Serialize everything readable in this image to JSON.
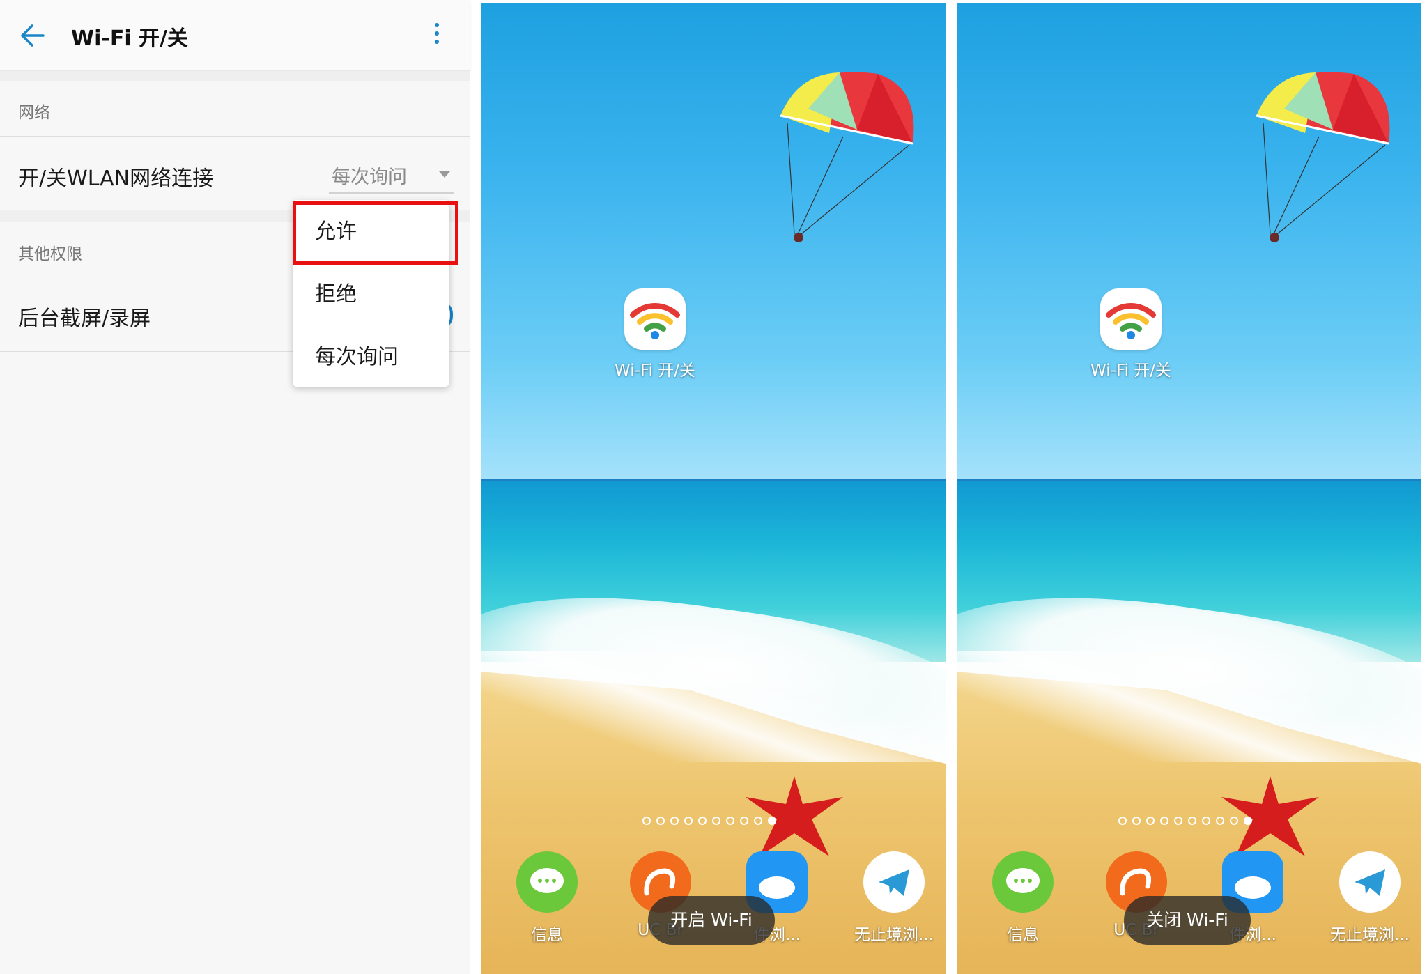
{
  "settings": {
    "title": "Wi-Fi 开/关",
    "sections": [
      {
        "header": "网络",
        "row_label": "开/关WLAN网络连接",
        "select_value": "每次询问"
      },
      {
        "header": "其他权限",
        "row_label": "后台截屏/录屏"
      }
    ],
    "menu": {
      "items": [
        "允许",
        "拒绝",
        "每次询问"
      ],
      "highlighted_index": 0
    },
    "accent_color": "#1a86c6",
    "highlight_color": "#e81010"
  },
  "home_a": {
    "wifi_app_label": "Wi-Fi 开/关",
    "dock": [
      "信息",
      "UC Br",
      "件浏...",
      "无止境浏..."
    ],
    "toast": "开启 Wi-Fi",
    "page_count": 10,
    "active_page": 10
  },
  "home_b": {
    "wifi_app_label": "Wi-Fi 开/关",
    "dock": [
      "信息",
      "UC Br",
      "件浏...",
      "无止境浏..."
    ],
    "toast": "关闭 Wi-Fi",
    "page_count": 10,
    "active_page": 10
  }
}
